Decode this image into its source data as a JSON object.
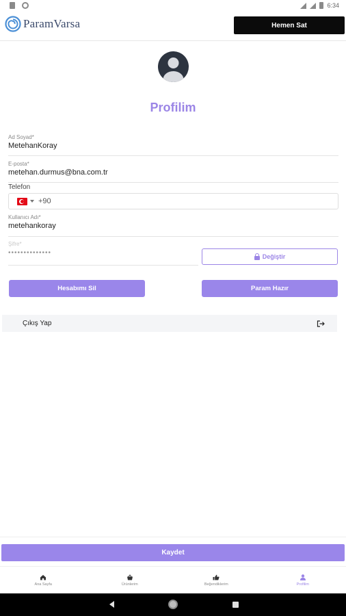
{
  "status": {
    "time": "6:34"
  },
  "header": {
    "brand": "ParamVarsa",
    "sell_button": "Hemen Sat"
  },
  "profile": {
    "title": "Profilim",
    "name_label": "Ad Soyad*",
    "name_value": "MetehanKoray",
    "email_label": "E-posta*",
    "email_value": "metehan.durmus@bna.com.tr",
    "phone_label": "Telefon",
    "phone_code": "+90",
    "username_label": "Kullanıcı Adı*",
    "username_value": "metehankoray",
    "password_label": "Şifre*",
    "password_value": "••••••••••••••",
    "change_button": "Değiştir",
    "delete_button": "Hesabımı Sil",
    "ready_button": "Param Hazır",
    "logout_label": "Çıkış Yap"
  },
  "footer": {
    "save_button": "Kaydet"
  },
  "tabs": [
    {
      "label": "Ana Sayfa",
      "icon": "home-icon"
    },
    {
      "label": "Ürünlerim",
      "icon": "basket-icon"
    },
    {
      "label": "Beğendiklerim",
      "icon": "thumbs-up-icon"
    },
    {
      "label": "Profilim",
      "icon": "user-icon",
      "active": true
    }
  ],
  "colors": {
    "accent": "#9a86ea",
    "dark": "#0b0b0b"
  }
}
